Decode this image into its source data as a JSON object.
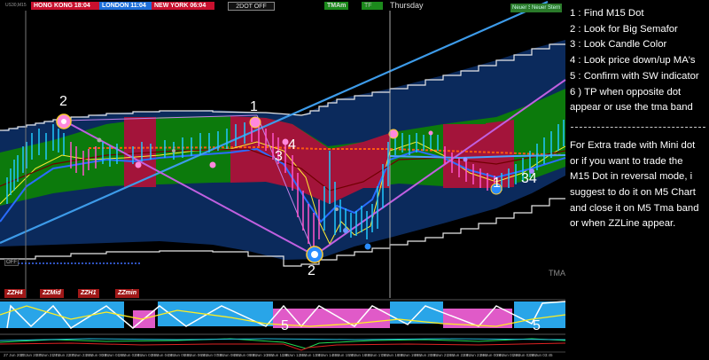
{
  "symbol": "US30,M15",
  "clocks": {
    "hong_kong": "HONG KONG 18:04",
    "london": "LONDON 11:04",
    "new_york": "NEW YORK 06:04"
  },
  "toolbar": {
    "dot_button": "2DOT OFF",
    "tma_tag": "TMAm",
    "tf_tag": "TF",
    "day": "Thursday",
    "right_tag_1": "Neuer Stern",
    "right_tag_2": "Neuer Stern"
  },
  "annotations": {
    "label_2_top": "2",
    "label_1_top": "1",
    "label_34_mid": "4",
    "label_3_mid": "3",
    "label_2_bottom": "2",
    "label_34_right": "34",
    "label_1_right": "1",
    "label_5_left": "5",
    "label_5_right": "5",
    "tma_label": "TMA",
    "off_label": "OFF"
  },
  "notes": {
    "steps": [
      "1 : Find M15 Dot",
      "2 : Look for Big Semafor",
      "3 : Look Candle Color",
      "4 : Look price down/up MA's",
      "5 : Confirm with SW indicator",
      "6 ) TP when opposite dot",
      "appear or use the tma band"
    ],
    "extra": [
      "For Extra trade with Mini dot",
      "or if you want to trade the",
      "M15 Dot in reversal mode, i",
      "suggest to do it on M5 Chart",
      "and close it on M5 Tma band",
      "or when ZZLine appear."
    ]
  },
  "zz_buttons": [
    "ZZH4",
    "ZZMid",
    "ZZH1",
    "ZZmin"
  ],
  "x_axis_labels": [
    "27 Jun 2023",
    "27 Jun 20:45",
    "27 Jun 21:45",
    "27 Jun 22:45",
    "27 Jun 23:45",
    "28 Jun 00:45",
    "28 Jun 01:45",
    "28 Jun 02:45",
    "28 Jun 03:45",
    "28 Jun 04:45",
    "28 Jun 05:45",
    "28 Jun 06:45",
    "28 Jun 07:45",
    "28 Jun 08:45",
    "28 Jun 09:45",
    "28 Jun 10:45",
    "28 Jun 11:45",
    "28 Jun 12:45",
    "28 Jun 13:45",
    "28 Jun 14:45",
    "28 Jun 15:45",
    "28 Jun 16:45",
    "28 Jun 17:45",
    "28 Jun 18:45",
    "28 Jun 19:45",
    "28 Jun 20:45",
    "28 Jun 21:45",
    "28 Jun 22:45",
    "28 Jun 23:45",
    "29 Jun 00:45",
    "29 Jun 01:45",
    "29 Jun 02:45",
    "29 Jun 03:45"
  ],
  "colors": {
    "band_outer": "#0b2a5c",
    "band_green": "#0c7a0c",
    "band_red": "#a3143a",
    "trendline_blue": "#3d9be9",
    "trendline_violet": "#c060e0",
    "zigzag_yellow": "#f0e040",
    "semafor_pink": "#ff88dd",
    "semafor_blue": "#2a8cff"
  }
}
